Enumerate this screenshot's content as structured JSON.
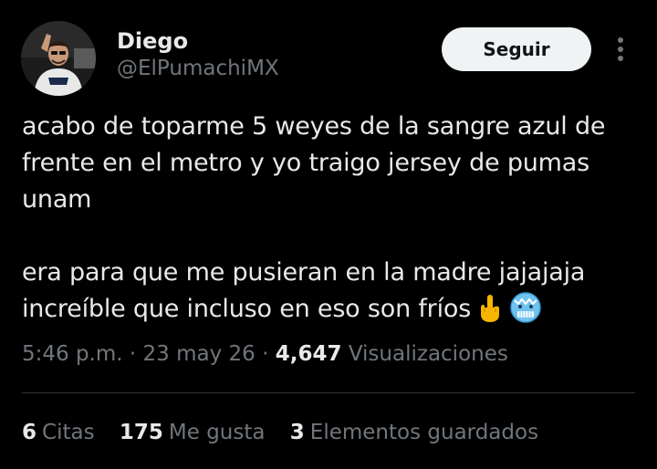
{
  "user": {
    "display_name": "Diego",
    "handle": "@ElPumachiMX"
  },
  "actions": {
    "follow_label": "Seguir",
    "more_icon": "more-vertical-icon"
  },
  "tweet": {
    "paragraph_1": "acabo de toparme 5 weyes de la sangre azul de frente en el metro y yo traigo jersey de pumas unam",
    "paragraph_2": "era para que me pusieran en la madre jajajaja increíble que incluso en eso son fríos",
    "emojis": [
      "middle-finger-emoji",
      "cold-face-emoji"
    ]
  },
  "meta": {
    "time": "5:46 p.m.",
    "separator": "·",
    "date": "23 may 26",
    "views_count": "4,647",
    "views_label": "Visualizaciones"
  },
  "stats": {
    "quotes_count": "6",
    "quotes_label": "Citas",
    "likes_count": "175",
    "likes_label": "Me gusta",
    "bookmarks_count": "3",
    "bookmarks_label": "Elementos guardados"
  },
  "colors": {
    "background": "#000000",
    "text_primary": "#e7e9ea",
    "text_secondary": "#71767b",
    "button_bg": "#eff3f4",
    "divider": "#2f3336"
  }
}
